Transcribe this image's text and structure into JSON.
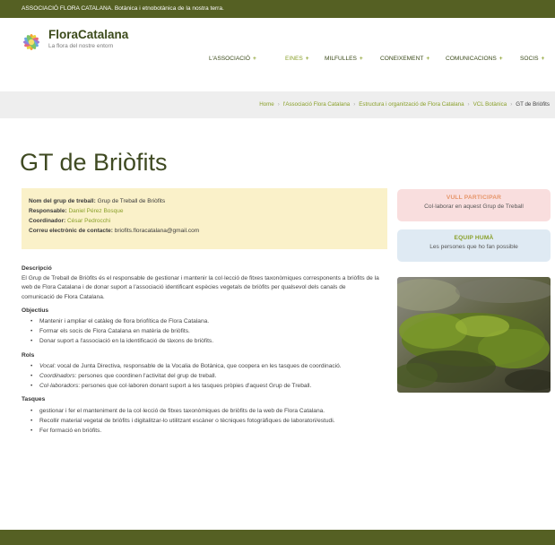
{
  "topbar": {
    "text": "ASSOCIACIÓ FLORA CATALANA. Botànica i etnobotànica de la nostra terra."
  },
  "logo": {
    "title": "FloraCatalana",
    "subtitle": "La flora del nostre entorn"
  },
  "nav": {
    "items": [
      {
        "label": "L'ASSOCIACIÓ",
        "plus": "+"
      },
      {
        "label": "EINES",
        "plus": "+"
      },
      {
        "label": "MILFULLES",
        "plus": "+"
      },
      {
        "label": "CONEIXEMENT",
        "plus": "+"
      },
      {
        "label": "COMUNICACIONS",
        "plus": "+"
      },
      {
        "label": "SOCIS",
        "plus": "+"
      }
    ],
    "active_color": "#8aa02b"
  },
  "breadcrumb": {
    "items": [
      "Home",
      "l'Associació Flora Catalana",
      "Estructura i organització de Flora Catalana",
      "VCL Botànica",
      "GT de Briòfits"
    ],
    "separator": "›"
  },
  "page": {
    "title": "GT de Briòfits"
  },
  "info": {
    "group_key": "Nom del grup de treball:",
    "group_val": "Grup de Treball de Briòfits",
    "resp_key": "Responsable:",
    "resp_val": "Daniel Pérez Bosque",
    "coord_key": "Coordinador:",
    "coord_val": "César Pedrocchi",
    "email_key": "Correu electrònic de contacte:",
    "email_val": "briofits.floracatalana@gmail.com"
  },
  "content": {
    "desc_title": "Descripció",
    "desc_text": "El Grup de Treball de Briòfits és el responsable de gestionar i mantenir la col·lecció de fitxes taxonòmiques corresponents a briòfits de la web de Flora Catalana i de donar suport a l'associació identificant espècies vegetals de briòfits per qualsevol dels canals de comunicació de Flora Catalana.",
    "obj_title": "Objectius",
    "objectives": [
      "Mantenir i ampliar el catàleg de flora briofítica de Flora Catalana.",
      "Formar els socis de Flora Catalana en matèria de briòfits.",
      "Donar suport a l'associació en la identificació de tàxons de briòfits."
    ],
    "rols_title": "Rols",
    "rols": [
      {
        "role": "Vocal",
        "text": ": vocal de Junta Directiva, responsable de la Vocalia de Botànica, que coopera en les tasques de coordinació."
      },
      {
        "role": "Coordinadors",
        "text": ": persones que coordinen l'activitat del grup de treball."
      },
      {
        "role": "Col·laboradors",
        "text": ": persones que col·laboren donant suport a les tasques pròpies d'aquest Grup de Treball."
      }
    ],
    "tasks_title": "Tasques",
    "tasks": [
      "gestionar i fer el manteniment de la col·lecció de fitxes taxonòmiques de briòfits de la web de Flora Catalana.",
      "Recollir material vegetal de briòfits i digitalitzar-lo utilitzant escàner o tècniques fotogràfiques de laboratori/estudi.",
      "Fer formació en briòfits."
    ]
  },
  "cards": {
    "participate_title": "VULL PARTICIPAR",
    "participate_sub": "Col·laborar en aquest Grup de Treball",
    "team_title": "EQUIP HUMÀ",
    "team_sub": "Les persones que ho fan possible"
  },
  "colors": {
    "brand_dark": "#556023",
    "accent": "#8aa02b",
    "info_bg": "#faf1c9"
  }
}
